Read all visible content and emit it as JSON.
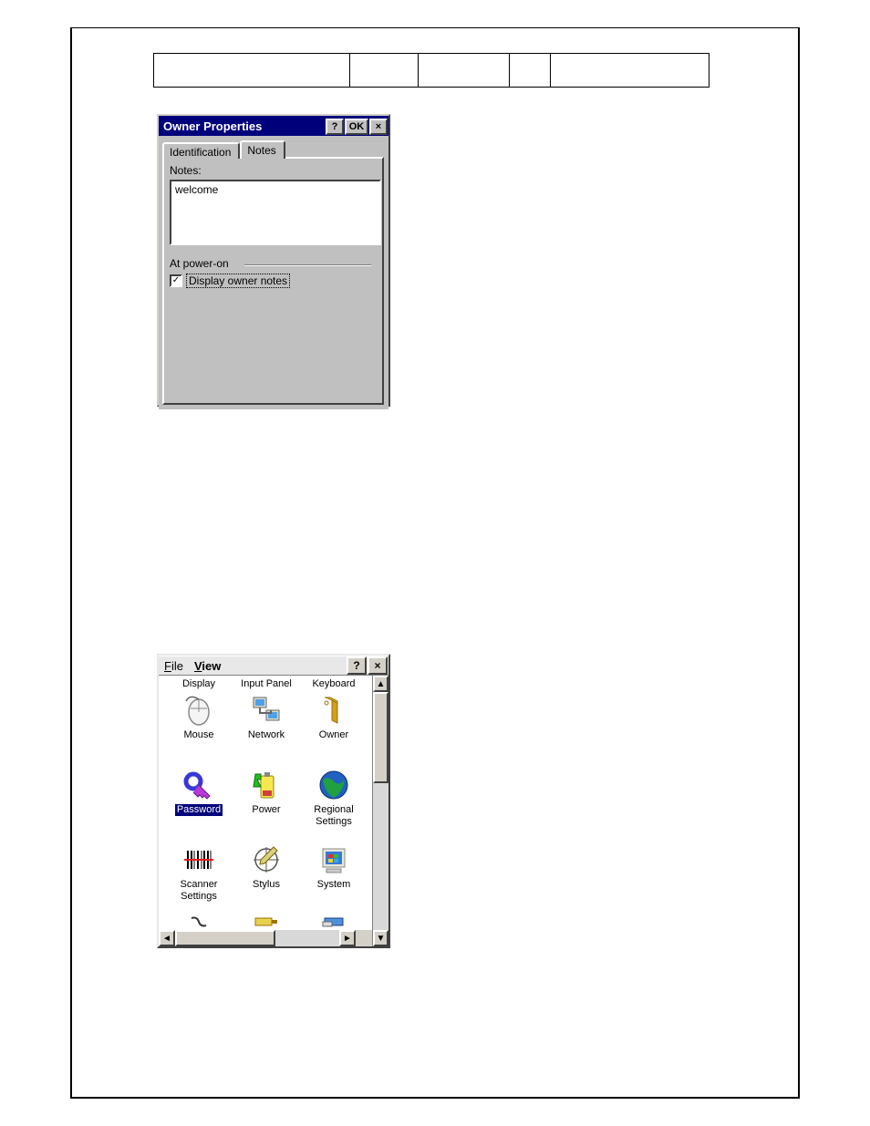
{
  "owner": {
    "title": "Owner Properties",
    "help_btn": "?",
    "ok_btn": "OK",
    "close_btn": "×",
    "tabs": {
      "identification": "Identification",
      "notes": "Notes"
    },
    "notes_label": "Notes:",
    "notes_value": "welcome",
    "group_label": "At power-on",
    "checkbox_label": "Display owner notes",
    "checkbox_checked": "✓"
  },
  "cpl": {
    "menu_file_u": "F",
    "menu_file_rest": "ile",
    "menu_view_u": "V",
    "menu_view_rest": "iew",
    "help_btn": "?",
    "close_btn": "×",
    "labels_row1": {
      "display": "Display",
      "input_panel": "Input Panel",
      "keyboard": "Keyboard"
    },
    "items": {
      "mouse": "Mouse",
      "network": "Network",
      "owner": "Owner",
      "password": "Password",
      "power": "Power",
      "regional": "Regional\nSettings",
      "scanner": "Scanner\nSettings",
      "stylus": "Stylus",
      "system": "System"
    },
    "scroll_up": "▲",
    "scroll_down": "▼",
    "scroll_left": "◄",
    "scroll_right": "►"
  }
}
